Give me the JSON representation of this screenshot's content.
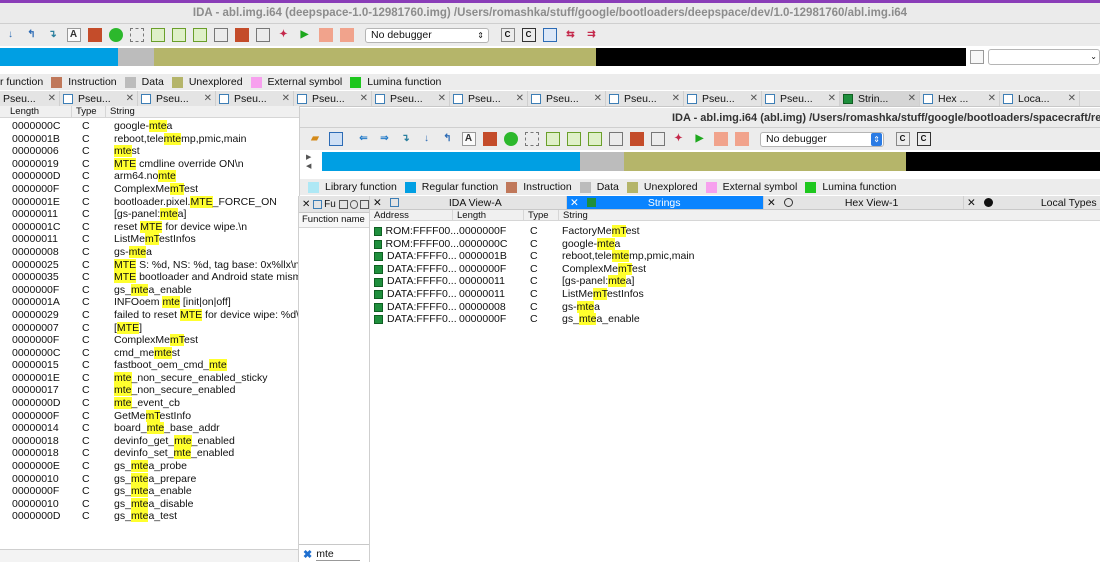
{
  "bg_window": {
    "title": "IDA - abl.img.i64 (deepspace-1.0-12981760.img) /Users/romashka/stuff/google/bootloaders/deepspace/dev/1.0-12981760/abl.img.i64",
    "debugger_label": "No debugger",
    "legend": [
      "r function",
      "Instruction",
      "Data",
      "Unexplored",
      "External symbol",
      "Lumina function"
    ],
    "tabs": [
      "Pseu...",
      "Pseu...",
      "Pseu...",
      "Pseu...",
      "Pseu...",
      "Pseu...",
      "Pseu...",
      "Pseu...",
      "Pseu...",
      "Pseu...",
      "Pseu...",
      "Strin...",
      "Hex ...",
      "Loca..."
    ],
    "columns": [
      "Length",
      "Type",
      "String"
    ],
    "strings": [
      {
        "length": "0000000C",
        "type": "C",
        "segs": [
          "google-",
          {
            "m": "mte"
          },
          "a"
        ]
      },
      {
        "length": "0000001B",
        "type": "C",
        "segs": [
          "reboot,tele",
          {
            "m": "mte"
          },
          "mp,pmic,main"
        ]
      },
      {
        "length": "00000006",
        "type": "C",
        "segs": [
          {
            "m": "mte"
          },
          "st"
        ]
      },
      {
        "length": "00000019",
        "type": "C",
        "segs": [
          {
            "m": "MTE"
          },
          " cmdline override ON\\n"
        ]
      },
      {
        "length": "0000000D",
        "type": "C",
        "segs": [
          " arm64.no",
          {
            "m": "mte"
          }
        ]
      },
      {
        "length": "0000000F",
        "type": "C",
        "segs": [
          "ComplexMe",
          {
            "m": "mT"
          },
          "est"
        ]
      },
      {
        "length": "0000001E",
        "type": "C",
        "segs": [
          "bootloader.pixel.",
          {
            "m": "MTE"
          },
          "_FORCE_ON"
        ]
      },
      {
        "length": "00000011",
        "type": "C",
        "segs": [
          "[gs-panel:",
          {
            "m": "mte"
          },
          "a]"
        ]
      },
      {
        "length": "0000001C",
        "type": "C",
        "segs": [
          "reset ",
          {
            "m": "MTE"
          },
          " for device wipe.\\n"
        ]
      },
      {
        "length": "00000011",
        "type": "C",
        "segs": [
          "ListMe",
          {
            "m": "mT"
          },
          "estInfos"
        ]
      },
      {
        "length": "00000008",
        "type": "C",
        "segs": [
          "gs-",
          {
            "m": "mte"
          },
          "a"
        ]
      },
      {
        "length": "00000025",
        "type": "C",
        "segs": [
          {
            "m": "MTE"
          },
          " S: %d, NS: %d, tag base: 0x%llx\\n"
        ]
      },
      {
        "length": "00000035",
        "type": "C",
        "segs": [
          {
            "m": "MTE"
          },
          " bootloader and Android state mismatch"
        ]
      },
      {
        "length": "0000000F",
        "type": "C",
        "segs": [
          "gs_",
          {
            "m": "mte"
          },
          "a_enable"
        ]
      },
      {
        "length": "0000001A",
        "type": "C",
        "segs": [
          "INFOoem ",
          {
            "m": "mte"
          },
          " [init|on|off]"
        ]
      },
      {
        "length": "00000029",
        "type": "C",
        "segs": [
          "failed to reset ",
          {
            "m": "MTE"
          },
          " for device wipe: %d\\n"
        ]
      },
      {
        "length": "00000007",
        "type": "C",
        "segs": [
          "[",
          {
            "m": "MTE"
          },
          "]"
        ]
      },
      {
        "length": "0000000F",
        "type": "C",
        "segs": [
          "ComplexMe",
          {
            "m": "mT"
          },
          "est"
        ]
      },
      {
        "length": "0000000C",
        "type": "C",
        "segs": [
          "cmd_me",
          {
            "m": "mte"
          },
          "st"
        ]
      },
      {
        "length": "00000015",
        "type": "C",
        "segs": [
          "fastboot_oem_cmd_",
          {
            "m": "mte"
          }
        ]
      },
      {
        "length": "0000001E",
        "type": "C",
        "segs": [
          {
            "m": "mte"
          },
          "_non_secure_enabled_sticky"
        ]
      },
      {
        "length": "00000017",
        "type": "C",
        "segs": [
          {
            "m": "mte"
          },
          "_non_secure_enabled"
        ]
      },
      {
        "length": "0000000D",
        "type": "C",
        "segs": [
          {
            "m": "mte"
          },
          "_event_cb"
        ]
      },
      {
        "length": "0000000F",
        "type": "C",
        "segs": [
          "GetMe",
          {
            "m": "mT"
          },
          "estInfo"
        ]
      },
      {
        "length": "00000014",
        "type": "C",
        "segs": [
          "board_",
          {
            "m": "mte"
          },
          "_base_addr"
        ]
      },
      {
        "length": "00000018",
        "type": "C",
        "segs": [
          "devinfo_get_",
          {
            "m": "mte"
          },
          "_enabled"
        ]
      },
      {
        "length": "00000018",
        "type": "C",
        "segs": [
          "devinfo_set_",
          {
            "m": "mte"
          },
          "_enabled"
        ]
      },
      {
        "length": "0000000E",
        "type": "C",
        "segs": [
          "gs_",
          {
            "m": "mte"
          },
          "a_probe"
        ]
      },
      {
        "length": "00000010",
        "type": "C",
        "segs": [
          "gs_",
          {
            "m": "mte"
          },
          "a_prepare"
        ]
      },
      {
        "length": "0000000F",
        "type": "C",
        "segs": [
          "gs_",
          {
            "m": "mte"
          },
          "a_enable"
        ]
      },
      {
        "length": "00000010",
        "type": "C",
        "segs": [
          "gs_",
          {
            "m": "mte"
          },
          "a_disable"
        ]
      },
      {
        "length": "0000000D",
        "type": "C",
        "segs": [
          "gs_",
          {
            "m": "mte"
          },
          "a_test"
        ]
      }
    ]
  },
  "fg_window": {
    "title": "IDA - abl.img.i64 (abl.img) /Users/romashka/stuff/google/bootloaders/spacecraft/rel/17.3-1562",
    "debugger_label": "No debugger",
    "legend": [
      "Library function",
      "Regular function",
      "Instruction",
      "Data",
      "Unexplored",
      "External symbol",
      "Lumina function"
    ],
    "func_panel_tab": "Fu",
    "func_column": "Function name",
    "filter_value": "mte",
    "tabs": [
      "IDA View-A",
      "Strings",
      "Hex View-1",
      "Local Types"
    ],
    "columns": [
      "Address",
      "Length",
      "Type",
      "String"
    ],
    "strings": [
      {
        "addr": "ROM:FFFF00...",
        "length": "0000000F",
        "type": "C",
        "segs": [
          "FactoryMe",
          {
            "m": "mT"
          },
          "est"
        ]
      },
      {
        "addr": "ROM:FFFF00...",
        "length": "0000000C",
        "type": "C",
        "segs": [
          "google-",
          {
            "m": "mte"
          },
          "a"
        ]
      },
      {
        "addr": "DATA:FFFF0...",
        "length": "0000001B",
        "type": "C",
        "segs": [
          "reboot,tele",
          {
            "m": "mte"
          },
          "mp,pmic,main"
        ]
      },
      {
        "addr": "DATA:FFFF0...",
        "length": "0000000F",
        "type": "C",
        "segs": [
          "ComplexMe",
          {
            "m": "mT"
          },
          "est"
        ]
      },
      {
        "addr": "DATA:FFFF0...",
        "length": "00000011",
        "type": "C",
        "segs": [
          "[gs-panel:",
          {
            "m": "mte"
          },
          "a]"
        ]
      },
      {
        "addr": "DATA:FFFF0...",
        "length": "00000011",
        "type": "C",
        "segs": [
          "ListMe",
          {
            "m": "mT"
          },
          "estInfos"
        ]
      },
      {
        "addr": "DATA:FFFF0...",
        "length": "00000008",
        "type": "C",
        "segs": [
          "gs-",
          {
            "m": "mte"
          },
          "a"
        ]
      },
      {
        "addr": "DATA:FFFF0...",
        "length": "0000000F",
        "type": "C",
        "segs": [
          "gs_",
          {
            "m": "mte"
          },
          "a_enable"
        ]
      }
    ]
  },
  "colors": {
    "library_function": "#aee8f5",
    "regular_function": "#009fe3",
    "instruction": "#c0785a",
    "data": "#bcbcbc",
    "unexplored": "#b5b56a",
    "external_symbol": "#f7a0ee",
    "lumina_function": "#1ec71e",
    "highlight": "#ffff2e",
    "selected_tab": "#0a84ff"
  }
}
